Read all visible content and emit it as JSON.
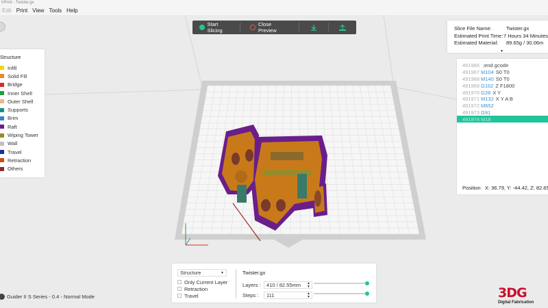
{
  "window": {
    "title": "hPrint - Twister.gx"
  },
  "menu": [
    {
      "label": "Edit",
      "disabled": true
    },
    {
      "label": "Print",
      "disabled": false
    },
    {
      "label": "View",
      "disabled": false
    },
    {
      "label": "Tools",
      "disabled": false
    },
    {
      "label": "Help",
      "disabled": false
    }
  ],
  "toolbar": {
    "start_slicing": "Start Slicing",
    "close_preview": "Close Preview",
    "accent_color": "#22c49a",
    "cancel_color": "#e05a5a"
  },
  "legend": {
    "title": "Structure",
    "items": [
      {
        "label": "Infill",
        "color": "#f2d516"
      },
      {
        "label": "Solid Fill",
        "color": "#e88a1a"
      },
      {
        "label": "Bridge",
        "color": "#d62a2a"
      },
      {
        "label": "Inner Shell",
        "color": "#21a03a"
      },
      {
        "label": "Outer Shell",
        "color": "#f2b48a"
      },
      {
        "label": "Supports",
        "color": "#1a8c8c"
      },
      {
        "label": "Brim",
        "color": "#3a7fd0"
      },
      {
        "label": "Raft",
        "color": "#6a1e8a"
      },
      {
        "label": "Wiping Tower",
        "color": "#9a8a2a"
      },
      {
        "label": "Wall",
        "color": "#bfbfbf"
      },
      {
        "label": "Travel",
        "color": "#1a2aa0"
      },
      {
        "label": "Retraction",
        "color": "#d04a1a"
      },
      {
        "label": "Others",
        "color": "#8a2a2a"
      }
    ]
  },
  "info": {
    "slice_file_label": "Slice File Name:",
    "slice_file_value": "Twister.gx",
    "print_time_label": "Estimated Print Time:",
    "print_time_value": "7 Hours 34 Minutes",
    "material_label": "Estimated Material:",
    "material_value": "89.65g / 30.06m"
  },
  "gcode": {
    "lines": [
      {
        "num": "491966",
        "cmd": "",
        "arg": ";end gcode",
        "active": false
      },
      {
        "num": "491967",
        "cmd": "M104",
        "arg": "S0 T0",
        "active": false
      },
      {
        "num": "491968",
        "cmd": "M140",
        "arg": "S0 T0",
        "active": false
      },
      {
        "num": "491969",
        "cmd": "G162",
        "arg": "Z F1800",
        "active": false
      },
      {
        "num": "491970",
        "cmd": "G28",
        "arg": "X Y",
        "active": false
      },
      {
        "num": "491971",
        "cmd": "M132",
        "arg": "X Y A B",
        "active": false
      },
      {
        "num": "491972",
        "cmd": "M652",
        "arg": "",
        "active": false
      },
      {
        "num": "491973",
        "cmd": "G91",
        "arg": "",
        "active": false
      },
      {
        "num": "491974",
        "cmd": "M18",
        "arg": "",
        "active": true
      }
    ],
    "position": "Position   X: 36.79, Y: -44.42, Z: 82.65"
  },
  "bottom": {
    "view_mode": "Structure",
    "only_current_layer": "Only Current Layer",
    "retraction": "Retraction",
    "travel": "Travel",
    "file_name": "Twister.gx",
    "layers_label": "Layers :",
    "layers_value": "410 / 82.55mm",
    "layers_fraction": 1.0,
    "steps_label": "Steps :",
    "steps_value": "111",
    "steps_fraction": 1.0
  },
  "status": {
    "text": "Guider II S Series - 0.4 - Normal Mode"
  },
  "logo": {
    "big": "3DG",
    "small": "Digital Fabrication"
  }
}
